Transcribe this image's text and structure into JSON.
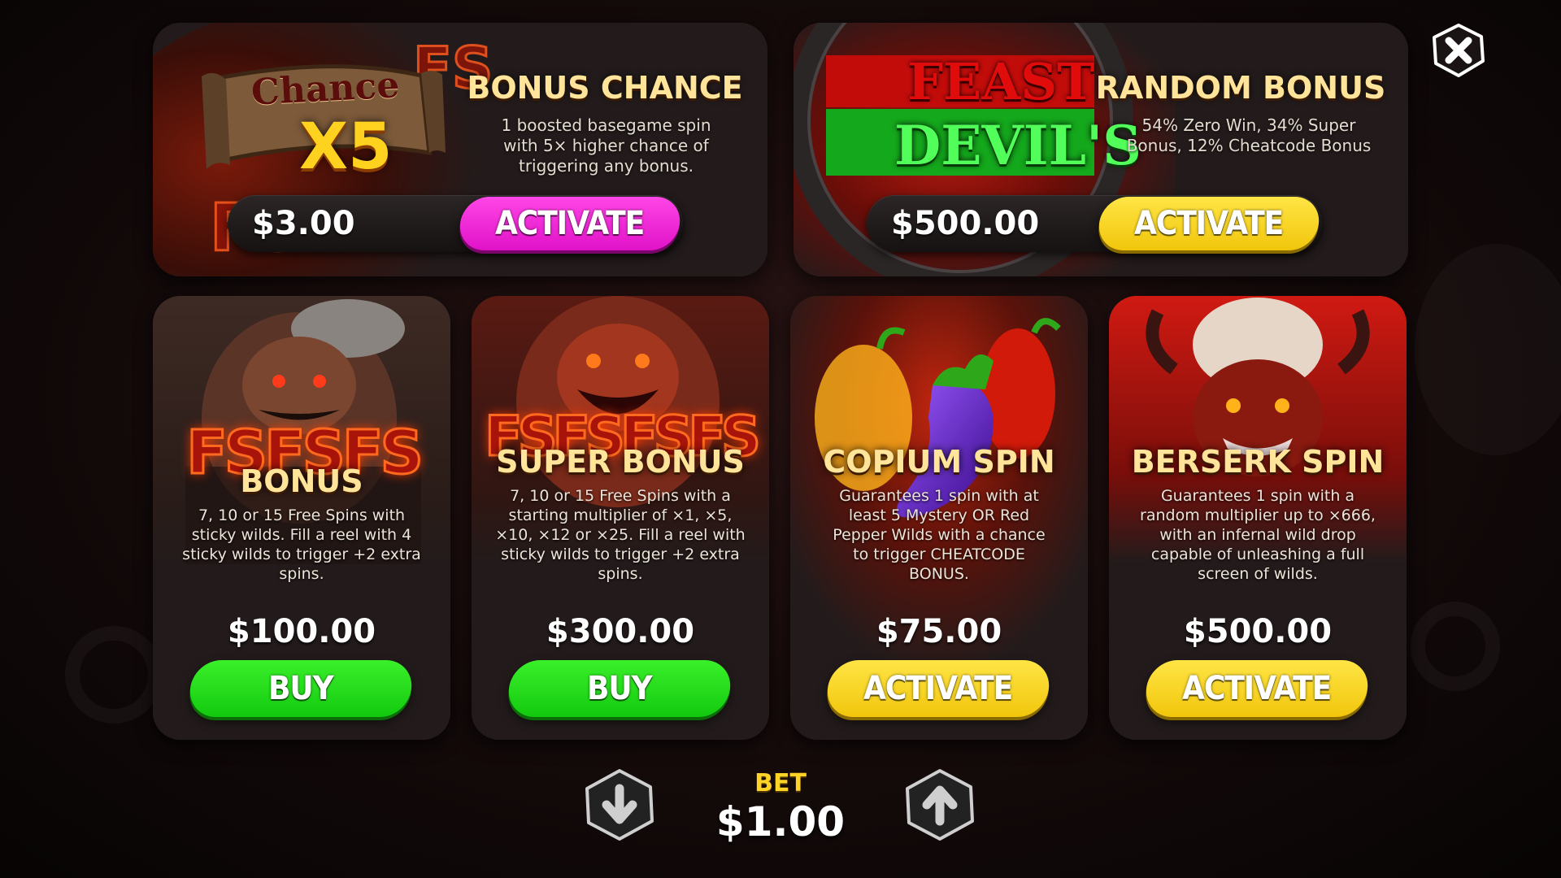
{
  "top_offers": [
    {
      "art_text_1": "Chance",
      "art_text_2": "X5",
      "title": "BONUS CHANCE",
      "description": [
        "1 boosted basegame spin",
        "with 5× higher chance of",
        "triggering any bonus."
      ],
      "price": "$3.00",
      "button": "ACTIVATE",
      "button_color": "#ff2fe0"
    },
    {
      "art_text_1": "FEAST",
      "art_text_2": "DEVIL'S",
      "title": "RANDOM BONUS",
      "description": [
        "54% Zero Win, 34% Super",
        "Bonus, 12% Cheatcode Bonus"
      ],
      "price": "$500.00",
      "button": "ACTIVATE",
      "button_color": "#ffd81f"
    }
  ],
  "cards": [
    {
      "art_text": "FSFSFS",
      "title": "BONUS",
      "description": [
        "7, 10 or 15 Free Spins with",
        "sticky wilds. Fill a reel with 4",
        "sticky wilds to trigger +2 extra",
        "spins."
      ],
      "price": "$100.00",
      "button": "BUY",
      "button_color": "#22dd18"
    },
    {
      "art_text": "FSFSFSFS",
      "title": "SUPER BONUS",
      "description": [
        "7, 10 or 15 Free Spins with a",
        "starting multiplier of ×1, ×5,",
        "×10, ×12 or ×25. Fill a reel with",
        "sticky wilds to trigger +2 extra",
        "spins."
      ],
      "price": "$300.00",
      "button": "BUY",
      "button_color": "#22dd18"
    },
    {
      "title": "COPIUM SPIN",
      "description": [
        "Guarantees 1 spin with at",
        "least 5 Mystery OR Red",
        "Pepper Wilds with a chance",
        "to trigger CHEATCODE",
        "BONUS."
      ],
      "price": "$75.00",
      "button": "ACTIVATE",
      "button_color": "#ffd81f"
    },
    {
      "title": "BERSERK SPIN",
      "description": [
        "Guarantees 1 spin with a",
        "random multiplier up to ×666,",
        "with an infernal wild drop",
        "capable of unleashing a full",
        "screen of wilds."
      ],
      "price": "$500.00",
      "button": "ACTIVATE",
      "button_color": "#ffd81f"
    }
  ],
  "bet": {
    "label": "BET",
    "value": "$1.00"
  },
  "icons": {
    "close": "close-icon",
    "decrease": "arrow-down-icon",
    "increase": "arrow-up-icon"
  }
}
